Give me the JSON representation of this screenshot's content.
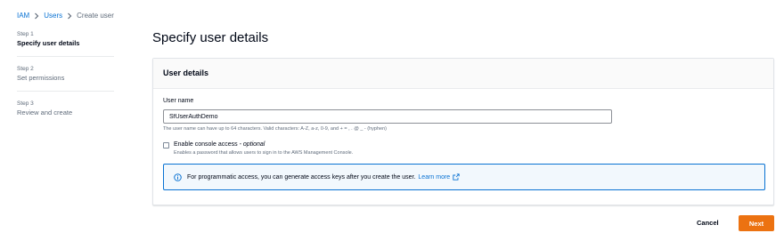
{
  "breadcrumb": {
    "items": [
      {
        "label": "IAM"
      },
      {
        "label": "Users"
      },
      {
        "label": "Create user"
      }
    ]
  },
  "steps": [
    {
      "number": "Step 1",
      "title": "Specify user details",
      "active": true
    },
    {
      "number": "Step 2",
      "title": "Set permissions",
      "active": false
    },
    {
      "number": "Step 3",
      "title": "Review and create",
      "active": false
    }
  ],
  "page": {
    "title": "Specify user details"
  },
  "user_details": {
    "header": "User details",
    "username_label": "User name",
    "username_value": "SfUserAuthDemo",
    "username_hint": "The user name can have up to 64 characters. Valid characters: A-Z, a-z, 0-9, and + = , . @ _ - (hyphen)",
    "console_access_label": "Enable console access",
    "console_access_optional": "- optional",
    "console_access_checked": false,
    "console_access_desc": "Enables a password that allows users to sign in to the AWS Management Console.",
    "info_text": "For programmatic access, you can generate access keys after you create the user.",
    "info_link": "Learn more"
  },
  "footer": {
    "cancel_label": "Cancel",
    "next_label": "Next"
  },
  "colors": {
    "link": "#0972d3",
    "primary_button": "#ec7211",
    "info_border": "#0972d3",
    "info_background": "#f2f8fd"
  },
  "icons": [
    "chevron-right-icon",
    "info-icon",
    "external-link-icon"
  ]
}
